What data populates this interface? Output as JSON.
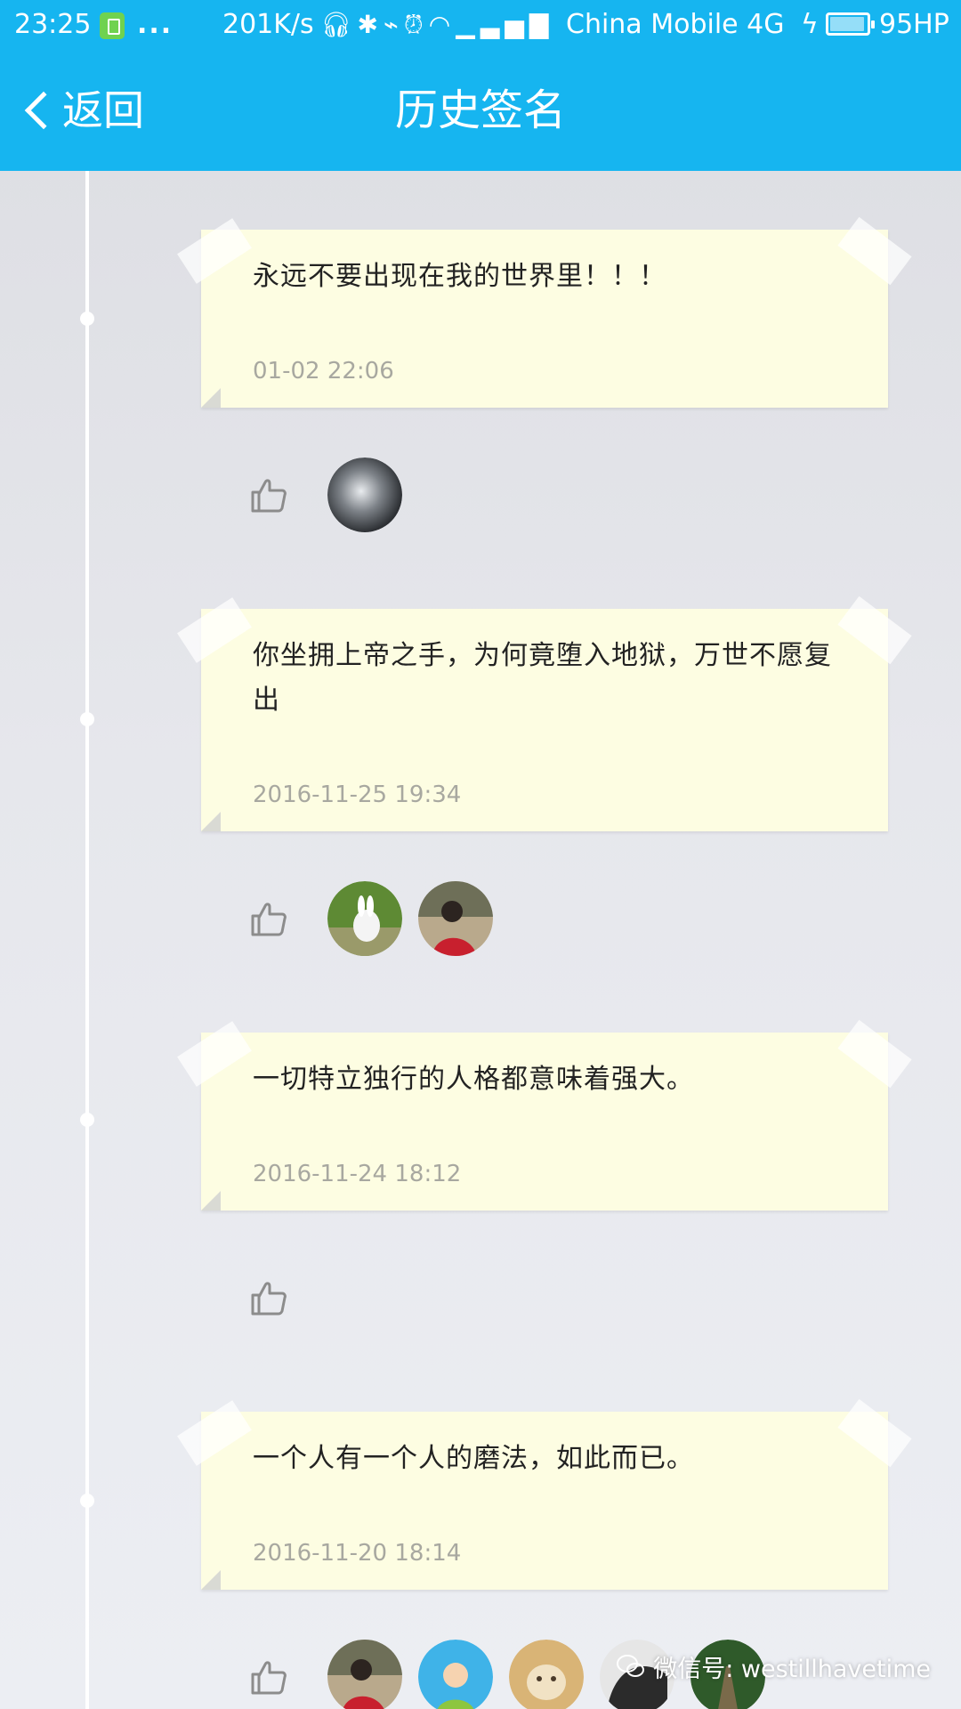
{
  "status_bar": {
    "time": "23:25",
    "dots": "...",
    "speed": "201K/s",
    "carrier": "China Mobile 4G",
    "battery": "95HP"
  },
  "nav": {
    "back_label": "返回",
    "title": "历史签名"
  },
  "signatures": [
    {
      "text": "永远不要出现在我的世界里！！！",
      "time": "01-02 22:06",
      "likes": [
        "avatar-cloud"
      ]
    },
    {
      "text": "你坐拥上帝之手，为何竟堕入地狱，万世不愿复出",
      "time": "2016-11-25 19:34",
      "likes": [
        "avatar-rabbit",
        "avatar-girl-red"
      ]
    },
    {
      "text": "一切特立独行的人格都意味着强大。",
      "time": "2016-11-24 18:12",
      "likes": []
    },
    {
      "text": "一个人有一个人的磨法，如此而已。",
      "time": "2016-11-20 18:14",
      "likes": [
        "avatar-girl-red",
        "avatar-cartoon",
        "avatar-pet",
        "avatar-bw",
        "avatar-forest"
      ]
    }
  ],
  "watermark": "微信号: westillhavetime",
  "colors": {
    "header": "#16b5f0",
    "note": "#fdfde2",
    "timestamp": "#a8a8a0",
    "background": "#e6e7ec"
  }
}
